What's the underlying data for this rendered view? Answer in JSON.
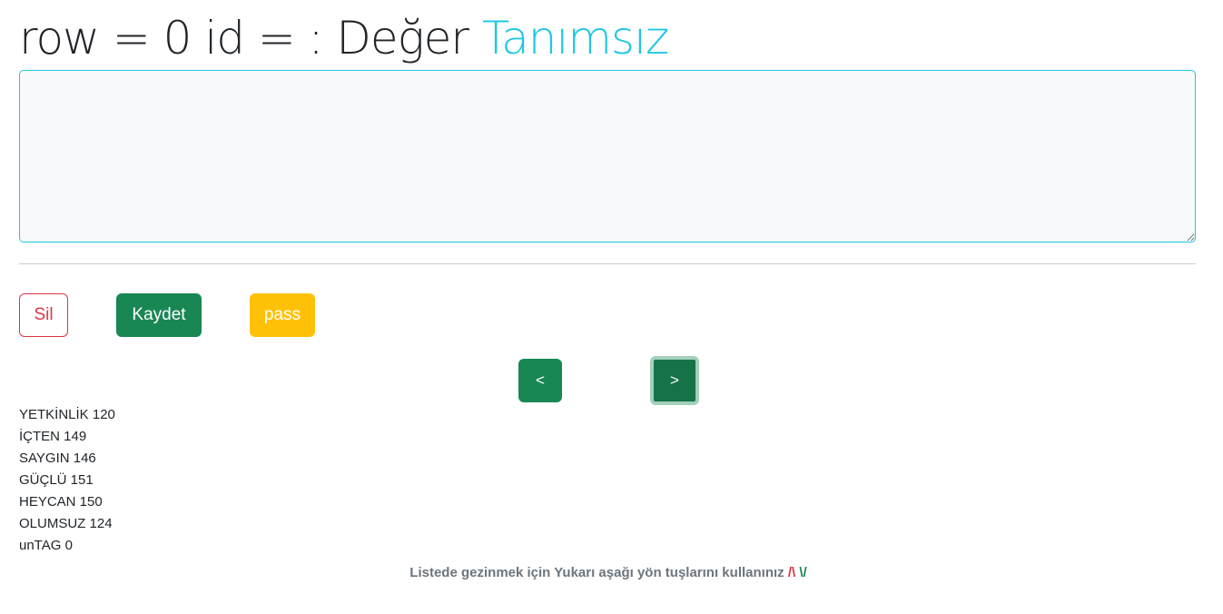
{
  "title": {
    "prefix": "row = 0 id = : Değer ",
    "value": "Tanımsız"
  },
  "textarea": {
    "value": ""
  },
  "buttons": {
    "delete": "Sil",
    "save": "Kaydet",
    "pass": "pass",
    "prev": "<",
    "next": ">"
  },
  "stats": [
    {
      "label": "YETKİNLİK 120"
    },
    {
      "label": "İÇTEN 149"
    },
    {
      "label": "SAYGIN 146"
    },
    {
      "label": "GÜÇLÜ 151"
    },
    {
      "label": "HEYCAN 150"
    },
    {
      "label": "OLUMSUZ 124"
    },
    {
      "label": "unTAG 0"
    }
  ],
  "hint": {
    "text": "Listede gezinmek için Yukarı aşağı yön tuşlarını kullanınız ",
    "up": "/\\",
    "down": "\\/"
  },
  "colors": {
    "accent": "#1fc8e3",
    "success": "#198754",
    "danger": "#dc3545",
    "warning": "#ffc107"
  }
}
